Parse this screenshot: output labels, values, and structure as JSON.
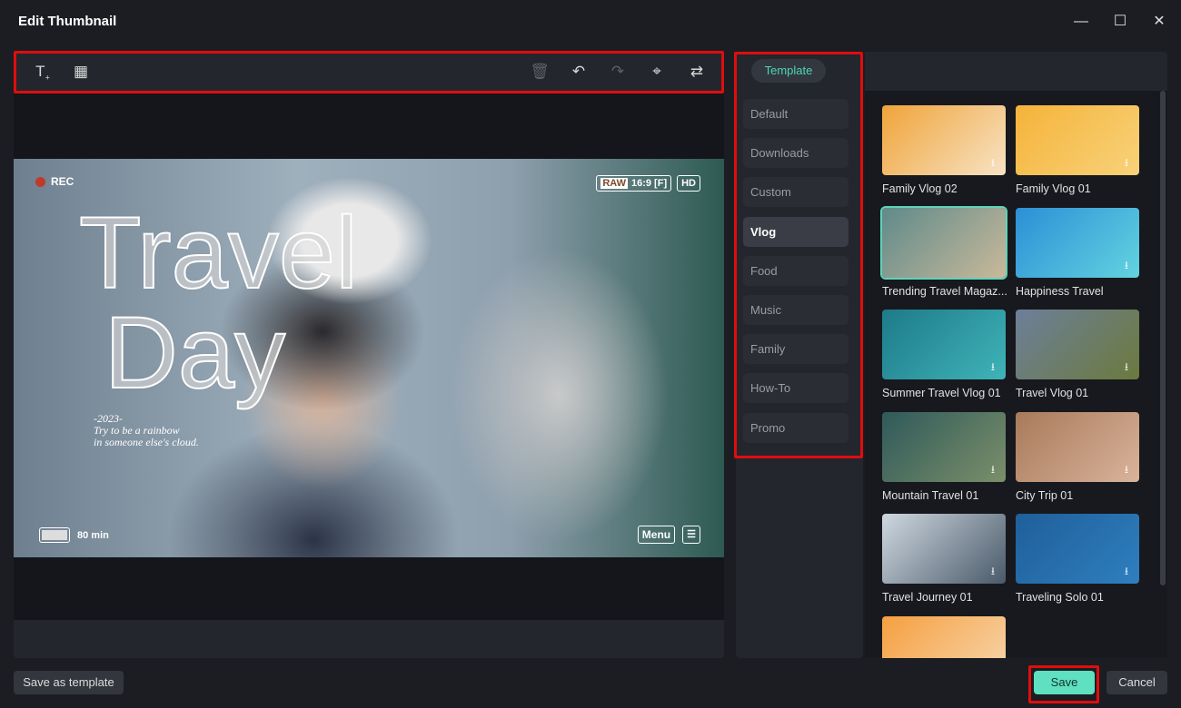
{
  "window": {
    "title": "Edit Thumbnail",
    "minimize_icon": "minimize-icon",
    "maximize_icon": "maximize-icon",
    "close_icon": "close-icon"
  },
  "toolbar": {
    "tools": [
      "add-text-icon",
      "add-image-icon"
    ],
    "actions": [
      {
        "icon": "trash-icon",
        "enabled": false
      },
      {
        "icon": "undo-icon",
        "enabled": true
      },
      {
        "icon": "redo-icon",
        "enabled": false
      },
      {
        "icon": "crop-icon",
        "enabled": true
      },
      {
        "icon": "replace-icon",
        "enabled": true
      }
    ]
  },
  "preview": {
    "rec": "REC",
    "raw": "RAW",
    "aspect": "16:9 [F]",
    "hd": "HD",
    "title_line1": "Travel",
    "title_line2": "Day",
    "year": "-2023-",
    "quote_line1": "Try to be a rainbow",
    "quote_line2": "in someone else's cloud.",
    "battery": "80 min",
    "menu": "Menu"
  },
  "sidebar": {
    "tab": "Template",
    "categories": [
      "Default",
      "Downloads",
      "Custom",
      "Vlog",
      "Food",
      "Music",
      "Family",
      "How-To",
      "Promo"
    ],
    "active": "Vlog"
  },
  "templates": [
    {
      "name": "Family Vlog 02",
      "download": true,
      "colors": [
        "#f0a43a",
        "#f7e3c4"
      ]
    },
    {
      "name": "Family Vlog 01",
      "download": true,
      "colors": [
        "#f5b33a",
        "#f8d27a"
      ]
    },
    {
      "name": "Trending Travel Magaz...",
      "download": false,
      "selected": true,
      "colors": [
        "#5f8a8a",
        "#c9b99a"
      ]
    },
    {
      "name": "Happiness Travel",
      "download": true,
      "colors": [
        "#2c8fd6",
        "#63d3e0"
      ]
    },
    {
      "name": "Summer Travel Vlog 01",
      "download": true,
      "colors": [
        "#1e7a8a",
        "#3fb4b8"
      ]
    },
    {
      "name": "Travel Vlog 01",
      "download": true,
      "colors": [
        "#6d7f9a",
        "#6b7a3d"
      ]
    },
    {
      "name": "Mountain Travel 01",
      "download": true,
      "colors": [
        "#2f5a5a",
        "#7b8f6a"
      ]
    },
    {
      "name": "City Trip 01",
      "download": true,
      "colors": [
        "#a87a5a",
        "#d9b39b"
      ]
    },
    {
      "name": "Travel Journey 01",
      "download": true,
      "colors": [
        "#cfd8e0",
        "#4a5a6a"
      ]
    },
    {
      "name": "Traveling Solo 01",
      "download": true,
      "colors": [
        "#1f5f9a",
        "#2f7fbf"
      ]
    },
    {
      "name": "",
      "download": false,
      "colors": [
        "#f5a040",
        "#f7d7b0"
      ]
    }
  ],
  "footer": {
    "save_as_template": "Save as template",
    "save": "Save",
    "cancel": "Cancel"
  },
  "colors": {
    "accent": "#4fd6b3",
    "save_button": "#5fe0c0",
    "highlight": "#e00d0d"
  }
}
